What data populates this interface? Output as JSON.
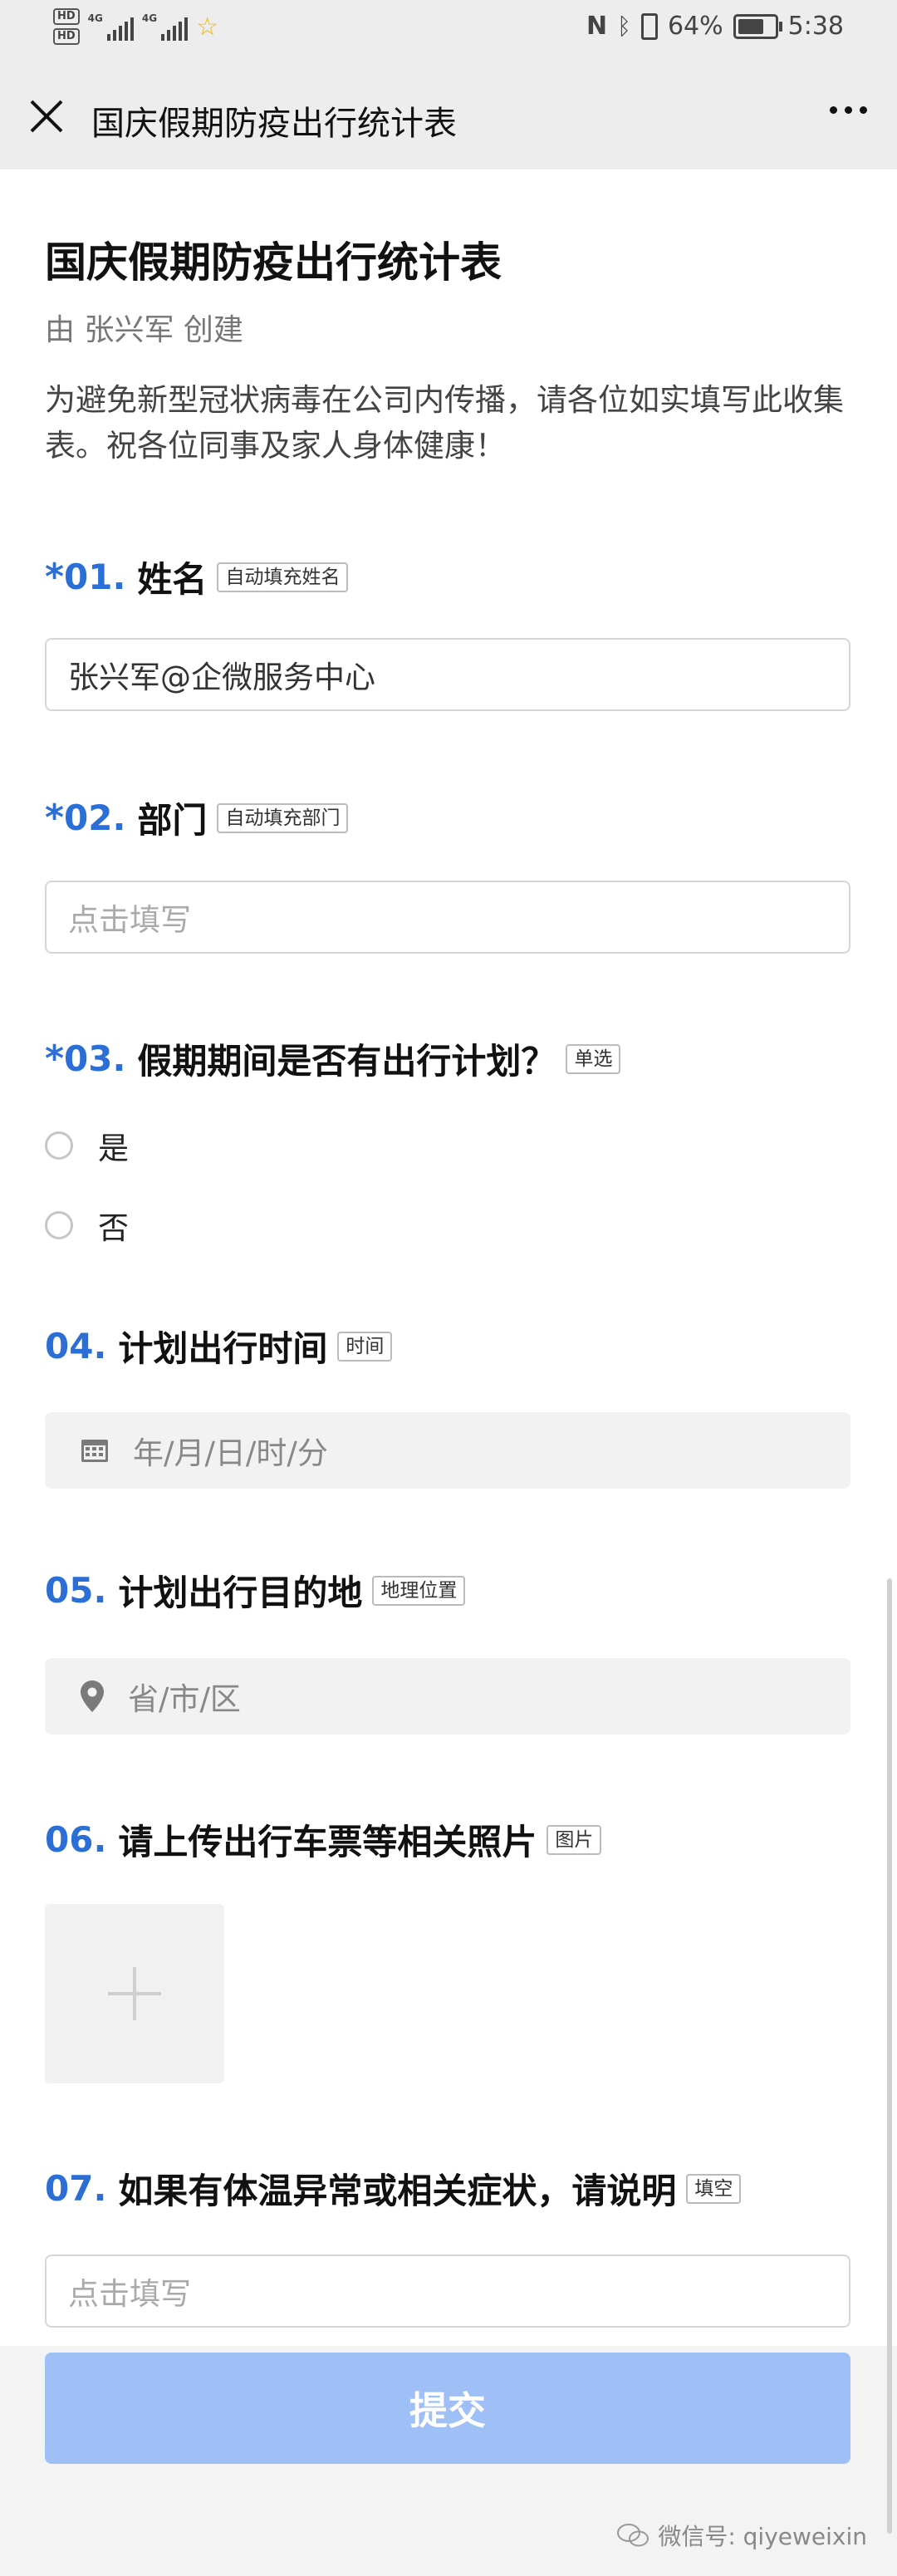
{
  "status_bar": {
    "hd1": "HD",
    "hd2": "HD",
    "net1": "4G",
    "net2": "4G",
    "battery_pct": "64%",
    "time": "5:38",
    "battery_level": 0.64
  },
  "nav": {
    "title": "国庆假期防疫出行统计表"
  },
  "form": {
    "title": "国庆假期防疫出行统计表",
    "creator": "由 张兴军 创建",
    "description": "为避免新型冠状病毒在公司内传播，请各位如实填写此收集表。祝各位同事及家人身体健康！"
  },
  "questions": [
    {
      "required": "*",
      "num": "01.",
      "label": "姓名",
      "tag": "自动填充姓名",
      "value": "张兴军@企微服务中心"
    },
    {
      "required": "*",
      "num": "02.",
      "label": "部门",
      "tag": "自动填充部门",
      "placeholder": "点击填写"
    },
    {
      "required": "*",
      "num": "03.",
      "label": "假期期间是否有出行计划？",
      "tag": "单选",
      "options": [
        "是",
        "否"
      ]
    },
    {
      "num": "04.",
      "label": "计划出行时间",
      "tag": "时间",
      "placeholder": "年/月/日/时/分"
    },
    {
      "num": "05.",
      "label": "计划出行目的地",
      "tag": "地理位置",
      "placeholder": "省/市/区"
    },
    {
      "num": "06.",
      "label": "请上传出行车票等相关照片",
      "tag": "图片"
    },
    {
      "num": "07.",
      "label": "如果有体温异常或相关症状，请说明",
      "tag": "填空",
      "placeholder": "点击填写"
    }
  ],
  "submit_label": "提交",
  "watermark": "微信号: qiyeweixin",
  "colors": {
    "accent": "#2b6fd6",
    "submit_disabled": "#9ec0f7"
  },
  "icons": {
    "close": "close-icon",
    "more": "more-icon",
    "calendar": "calendar-icon",
    "location": "location-pin-icon",
    "add": "plus-icon"
  }
}
